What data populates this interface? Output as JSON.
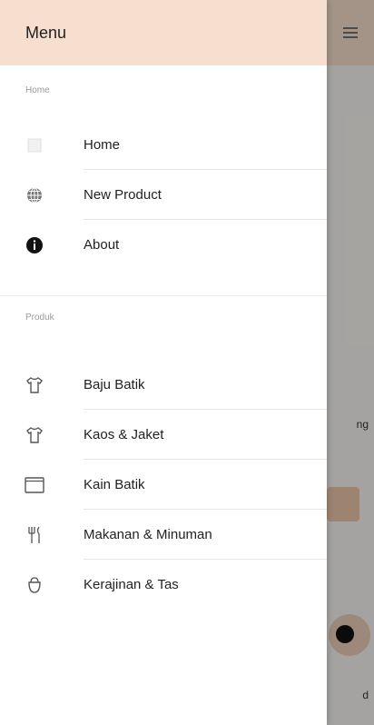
{
  "header": {
    "title": "Menu"
  },
  "sections": [
    {
      "label": "Home",
      "items": [
        {
          "label": "Home",
          "icon": "home-icon"
        },
        {
          "label": "New Product",
          "icon": "globe-icon"
        },
        {
          "label": "About",
          "icon": "info-icon"
        }
      ]
    },
    {
      "label": "Produk",
      "items": [
        {
          "label": "Baju Batik",
          "icon": "shirt-icon"
        },
        {
          "label": "Kaos & Jaket",
          "icon": "shirt-icon"
        },
        {
          "label": "Kain Batik",
          "icon": "cloth-icon"
        },
        {
          "label": "Makanan & Minuman",
          "icon": "utensils-icon"
        },
        {
          "label": "Kerajinan & Tas",
          "icon": "bag-icon"
        }
      ]
    }
  ],
  "background": {
    "partial_text_1": "ng",
    "partial_text_2": "d"
  },
  "colors": {
    "header_bg": "#f7dfcf",
    "accent": "#e6c3a7"
  }
}
